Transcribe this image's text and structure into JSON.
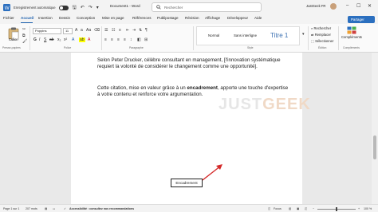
{
  "titlebar": {
    "autosave_label": "Enregistrement automatique",
    "document_name": "Document1 - Word",
    "search_placeholder": "Rechercher",
    "user_name": "JustGeek FR"
  },
  "menu": {
    "items": [
      "Fichier",
      "Accueil",
      "Insertion",
      "Dessin",
      "Conception",
      "Mise en page",
      "Références",
      "Publipostage",
      "Révision",
      "Affichage",
      "Développeur",
      "Aide"
    ],
    "share_label": "Partager"
  },
  "ribbon": {
    "paste_label": "Coller",
    "font_name": "Poppins",
    "font_size": "11",
    "styles": [
      "Normal",
      "Sans interligne",
      "Titre 1"
    ],
    "edit_items": [
      "Rechercher",
      "Remplacer",
      "Sélectionner"
    ],
    "complements_label": "Compléments",
    "group_labels": [
      "Presse-papiers",
      "Police",
      "Paragraphe",
      "Style",
      "Édition",
      "Compléments"
    ]
  },
  "document": {
    "para1": "Selon Peter Drucker, célèbre consultant en management, [l'innovation systématique requiert la volonté de considérer le changement comme une opportunité].",
    "para2_before": "Cette citation, mise en valeur grâce à un ",
    "para2_bold": "encadrement",
    "para2_after": ", apporte une touche d'expertise à votre contenu et renforce votre argumentation.",
    "watermark_part1": "JUST",
    "watermark_part2": "GEEK",
    "callout_label": "Encadrement"
  },
  "statusbar": {
    "page": "Page 1 sur 1",
    "words": "207 mots",
    "accessibility": "Accessibilité : consultez nos recommandations",
    "focus": "Focus",
    "zoom": "100 %"
  }
}
